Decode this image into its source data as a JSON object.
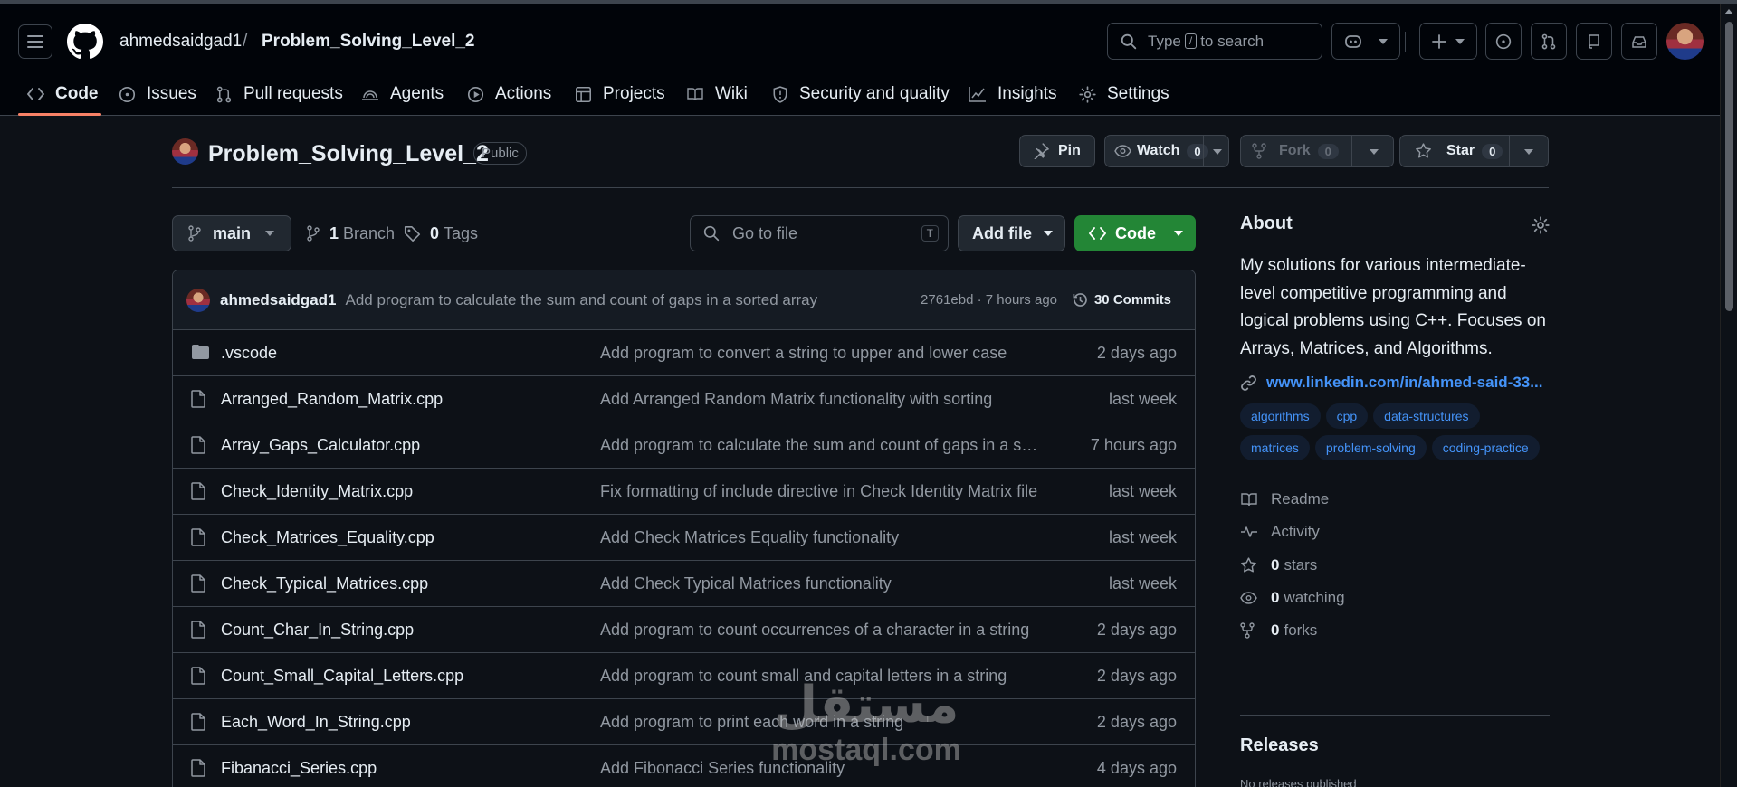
{
  "header": {
    "owner": "ahmedsaidgad1",
    "separator": "/",
    "repo": "Problem_Solving_Level_2",
    "search": {
      "before": "Type",
      "key": "/",
      "after": "to search"
    }
  },
  "nav": {
    "tabs": [
      {
        "label": "Code",
        "icon": "code-icon"
      },
      {
        "label": "Issues",
        "icon": "issue-icon"
      },
      {
        "label": "Pull requests",
        "icon": "pull-request-icon"
      },
      {
        "label": "Agents",
        "icon": "agent-icon"
      },
      {
        "label": "Actions",
        "icon": "play-icon"
      },
      {
        "label": "Projects",
        "icon": "table-icon"
      },
      {
        "label": "Wiki",
        "icon": "book-icon"
      },
      {
        "label": "Security and quality",
        "icon": "shield-icon"
      },
      {
        "label": "Insights",
        "icon": "graph-icon"
      },
      {
        "label": "Settings",
        "icon": "gear-icon"
      }
    ]
  },
  "repo_head": {
    "title": "Problem_Solving_Level_2",
    "visibility": "Public",
    "pin": "Pin",
    "watch": "Watch",
    "watch_count": "0",
    "fork": "Fork",
    "fork_count": "0",
    "star": "Star",
    "star_count": "0"
  },
  "toolbar": {
    "branch": "main",
    "branch_count": "1",
    "branch_label": "Branch",
    "tag_count": "0",
    "tag_label": "Tags",
    "go_to_file": "Go to file",
    "go_key": "T",
    "add_file": "Add file",
    "code": "Code"
  },
  "commit": {
    "user": "ahmedsaidgad1",
    "message": "Add program to calculate the sum and count of gaps in a sorted array",
    "hash_time": "2761ebd · 7 hours ago",
    "commits": "30 Commits"
  },
  "files": [
    {
      "name": ".vscode",
      "type": "folder",
      "message": "Add program to convert a string to upper and lower case",
      "date": "2 days ago"
    },
    {
      "name": "Arranged_Random_Matrix.cpp",
      "type": "file",
      "message": "Add Arranged Random Matrix functionality with sorting",
      "date": "last week"
    },
    {
      "name": "Array_Gaps_Calculator.cpp",
      "type": "file",
      "message": "Add program to calculate the sum and count of gaps in a sor…",
      "date": "7 hours ago"
    },
    {
      "name": "Check_Identity_Matrix.cpp",
      "type": "file",
      "message": "Fix formatting of include directive in Check Identity Matrix file",
      "date": "last week"
    },
    {
      "name": "Check_Matrices_Equality.cpp",
      "type": "file",
      "message": "Add Check Matrices Equality functionality",
      "date": "last week"
    },
    {
      "name": "Check_Typical_Matrices.cpp",
      "type": "file",
      "message": "Add Check Typical Matrices functionality",
      "date": "last week"
    },
    {
      "name": "Count_Char_In_String.cpp",
      "type": "file",
      "message": "Add program to count occurrences of a character in a string",
      "date": "2 days ago"
    },
    {
      "name": "Count_Small_Capital_Letters.cpp",
      "type": "file",
      "message": "Add program to count small and capital letters in a string",
      "date": "2 days ago"
    },
    {
      "name": "Each_Word_In_String.cpp",
      "type": "file",
      "message": "Add program to print each word in a string",
      "date": "2 days ago"
    },
    {
      "name": "Fibanacci_Series.cpp",
      "type": "file",
      "message": "Add Fibonacci Series functionality",
      "date": "4 days ago"
    }
  ],
  "about": {
    "title": "About",
    "description": "My solutions for various intermediate-level competitive programming and logical problems using C++. Focuses on Arrays, Matrices, and Algorithms.",
    "link": "www.linkedin.com/in/ahmed-said-33...",
    "topics": [
      "algorithms",
      "cpp",
      "data-structures",
      "matrices",
      "problem-solving",
      "coding-practice"
    ],
    "readme": "Readme",
    "activity": "Activity",
    "stars_count": "0",
    "stars_label": "stars",
    "watching_count": "0",
    "watching_label": "watching",
    "forks_count": "0",
    "forks_label": "forks"
  },
  "releases": {
    "title": "Releases",
    "note": "No releases published"
  },
  "watermark": {
    "arabic": "مستقل",
    "latin": "mostaql.com"
  },
  "colors": {
    "background": "#0d1117",
    "accent_link": "#4493f8",
    "code_button": "#238636",
    "tab_underline": "#f78166"
  }
}
